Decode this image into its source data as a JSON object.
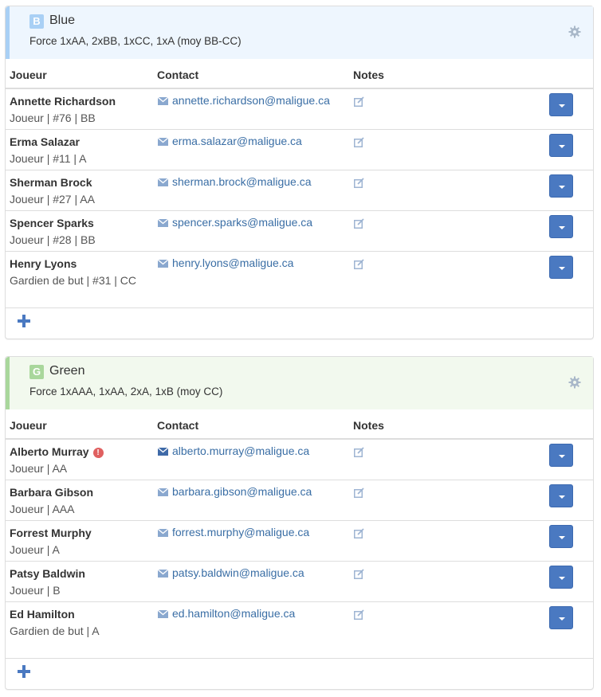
{
  "teams": [
    {
      "badge": "B",
      "name": "Blue",
      "force": "Force 1xAA, 2xBB, 1xCC, 1xA (moy BB-CC)",
      "color": "#a9d0f5",
      "headers": {
        "player": "Joueur",
        "contact": "Contact",
        "notes": "Notes"
      },
      "players": [
        {
          "name": "Annette Richardson",
          "meta": "Joueur | #76 | BB",
          "email": "annette.richardson@maligue.ca"
        },
        {
          "name": "Erma Salazar",
          "meta": "Joueur | #11 | A",
          "email": "erma.salazar@maligue.ca"
        },
        {
          "name": "Sherman Brock",
          "meta": "Joueur | #27 | AA",
          "email": "sherman.brock@maligue.ca"
        },
        {
          "name": "Spencer Sparks",
          "meta": "Joueur | #28 | BB",
          "email": "spencer.sparks@maligue.ca"
        },
        {
          "name": "Henry Lyons",
          "meta": "Gardien de but | #31 | CC",
          "email": "henry.lyons@maligue.ca"
        }
      ]
    },
    {
      "badge": "G",
      "name": "Green",
      "force": "Force 1xAAA, 1xAA, 2xA, 1xB (moy CC)",
      "color": "#a9d79c",
      "headers": {
        "player": "Joueur",
        "contact": "Contact",
        "notes": "Notes"
      },
      "players": [
        {
          "name": "Alberto Murray",
          "meta": "Joueur | AA",
          "email": "alberto.murray@maligue.ca",
          "alert": "!"
        },
        {
          "name": "Barbara Gibson",
          "meta": "Joueur | AAA",
          "email": "barbara.gibson@maligue.ca"
        },
        {
          "name": "Forrest Murphy",
          "meta": "Joueur | A",
          "email": "forrest.murphy@maligue.ca"
        },
        {
          "name": "Patsy Baldwin",
          "meta": "Joueur | B",
          "email": "patsy.baldwin@maligue.ca"
        },
        {
          "name": "Ed Hamilton",
          "meta": "Gardien de but | A",
          "email": "ed.hamilton@maligue.ca"
        }
      ]
    }
  ],
  "icons": {
    "gear": "gear-icon",
    "mail": "envelope-icon",
    "edit": "edit-icon",
    "dropdown": "caret-down-icon",
    "add": "plus-icon",
    "alert": "exclamation-icon"
  },
  "colors": {
    "link": "#3a6ea5",
    "button": "#4a79c1"
  }
}
